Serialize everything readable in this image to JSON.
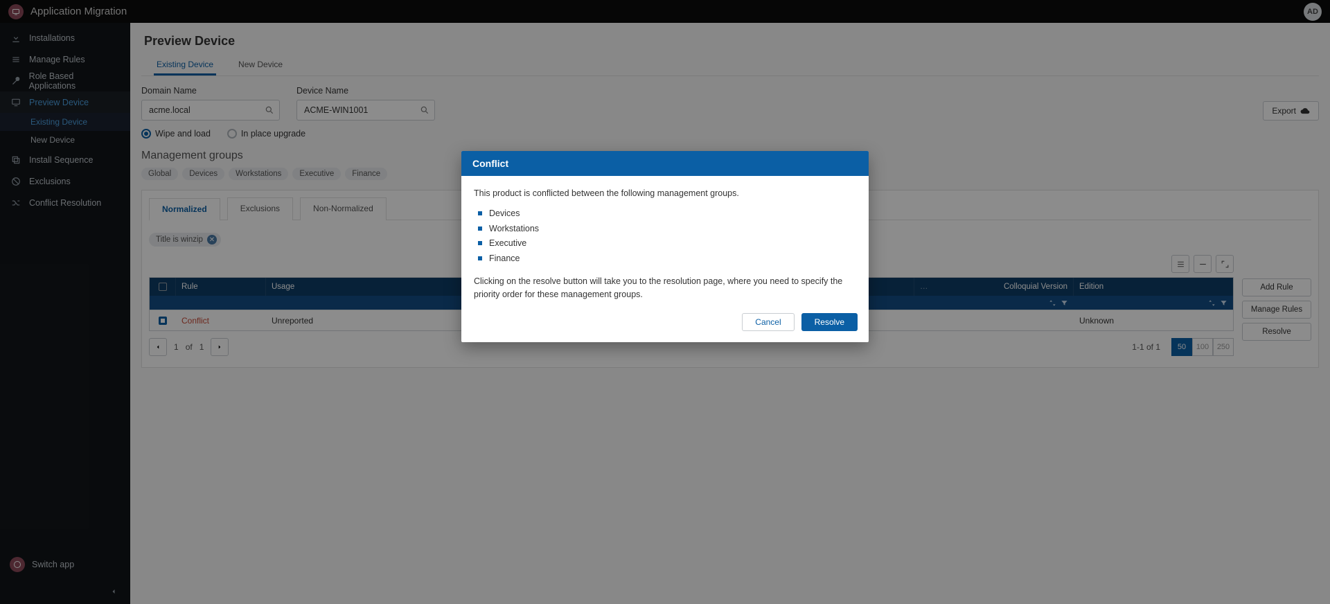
{
  "header": {
    "app_title": "Application Migration",
    "avatar": "AD"
  },
  "sidebar": {
    "items": [
      {
        "label": "Installations"
      },
      {
        "label": "Manage Rules"
      },
      {
        "label": "Role Based Applications"
      },
      {
        "label": "Preview Device"
      },
      {
        "label": "Existing Device"
      },
      {
        "label": "New Device"
      },
      {
        "label": "Install Sequence"
      },
      {
        "label": "Exclusions"
      },
      {
        "label": "Conflict Resolution"
      }
    ],
    "switch_app": "Switch app"
  },
  "page": {
    "title": "Preview Device",
    "tabs": {
      "existing": "Existing Device",
      "new": "New Device"
    },
    "domain_label": "Domain Name",
    "device_label": "Device Name",
    "domain_value": "acme.local",
    "device_value": "ACME-WIN1001",
    "export": "Export",
    "radio_wipe": "Wipe and load",
    "radio_upgrade": "In place upgrade",
    "mg_label": "Management groups",
    "mg_chips": [
      "Global",
      "Devices",
      "Workstations",
      "Executive",
      "Finance"
    ],
    "subtabs": {
      "normalized": "Normalized",
      "exclusions": "Exclusions",
      "nonnorm": "Non-Normalized"
    },
    "filter_chip": "Title is winzip",
    "columns": {
      "rule": "Rule",
      "usage": "Usage",
      "colloquial": "Colloquial Version",
      "edition": "Edition"
    },
    "row": {
      "rule": "Conflict",
      "usage": "Unreported",
      "edition": "Unknown"
    },
    "actions": {
      "add": "Add Rule",
      "manage": "Manage Rules",
      "resolve": "Resolve"
    },
    "pager": {
      "page": "1",
      "of": "of",
      "total": "1",
      "range": "1-1 of 1",
      "sizes": [
        "50",
        "100",
        "250"
      ]
    }
  },
  "modal": {
    "title": "Conflict",
    "intro": "This product is conflicted between the following management groups.",
    "groups": [
      "Devices",
      "Workstations",
      "Executive",
      "Finance"
    ],
    "help": "Clicking on the resolve button will take you to the resolution page, where you need to specify the priority order for these management groups.",
    "cancel": "Cancel",
    "resolve": "Resolve"
  }
}
